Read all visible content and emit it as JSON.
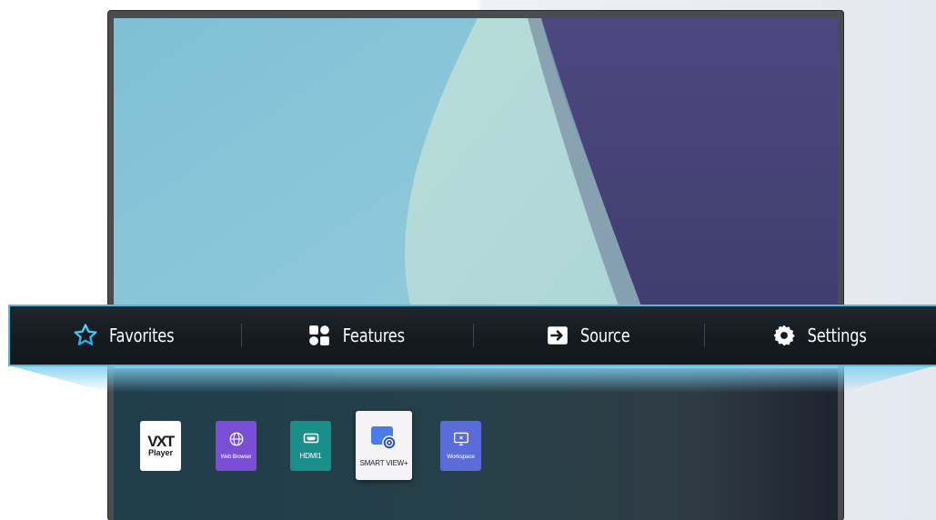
{
  "menu": {
    "items": [
      {
        "label": "Favorites",
        "icon": "star-icon"
      },
      {
        "label": "Features",
        "icon": "features-grid-icon"
      },
      {
        "label": "Source",
        "icon": "source-input-icon"
      },
      {
        "label": "Settings",
        "icon": "gear-icon"
      }
    ],
    "accent": "#59b6da"
  },
  "apps": [
    {
      "name": "vxt-player",
      "line1": "VXT",
      "line2": "Player",
      "color": "#ffffff"
    },
    {
      "name": "web-browser",
      "label": "Web Browser",
      "color": "#7a4fd6"
    },
    {
      "name": "hdmi1",
      "label": "HDMI1",
      "color": "#1a8f8a"
    },
    {
      "name": "smart-view-plus",
      "label": "SMART VIEW+",
      "color": "#f4f4f6",
      "selected": true
    },
    {
      "name": "workspace",
      "label": "Workspace",
      "color": "#5a6cd8"
    }
  ]
}
